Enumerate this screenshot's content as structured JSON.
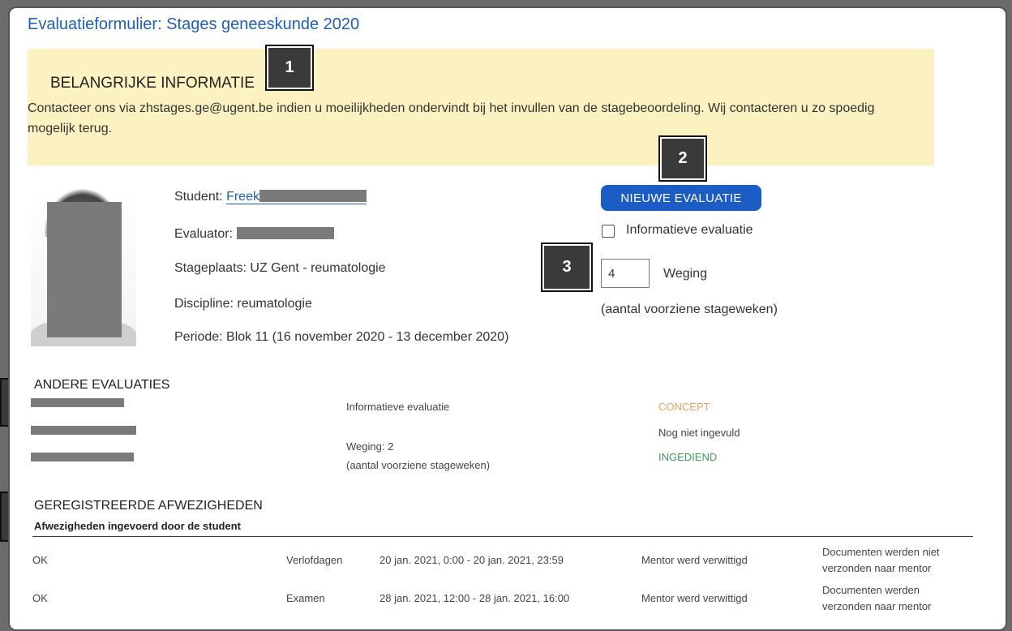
{
  "page": {
    "title": "Evaluatieformulier: Stages geneeskunde 2020"
  },
  "info": {
    "heading": "BELANGRIJKE INFORMATIE",
    "text": "Contacteer ons via zhstages.ge@ugent.be indien u moeilijkheden ondervindt bij het invullen van de stagebeoordeling. Wij contacteren u zo spoedig mogelijk terug."
  },
  "callouts": {
    "c1": "1",
    "c2": "2",
    "c3": "3"
  },
  "student": {
    "label": "Student:",
    "name": "Freek",
    "evaluator_label": "Evaluator:",
    "stageplaats": "Stageplaats: UZ Gent - reumatologie",
    "discipline": "Discipline: reumatologie",
    "periode": "Periode: Blok 11 (16 november 2020 - 13 december 2020)"
  },
  "actions": {
    "new_evaluation": "NIEUWE EVALUATIE",
    "informative_label": "Informatieve evaluatie",
    "weging_value": "4",
    "weging_label": "Weging",
    "weging_note": "(aantal voorziene stageweken)"
  },
  "other_evaluations": {
    "heading": "ANDERE EVALUATIES",
    "col2": {
      "informative": "Informatieve evaluatie",
      "weging": "Weging: 2",
      "weging_note": "(aantal voorziene stageweken)"
    },
    "statuses": {
      "concept": "CONCEPT",
      "not_filled": "Nog niet ingevuld",
      "ingediend": "INGEDIEND"
    },
    "colors": {
      "concept": "#e8a35a",
      "ingediend": "#3f9a5a"
    }
  },
  "absences": {
    "heading": "GEREGISTREERDE AFWEZIGHEDEN",
    "subheading": "Afwezigheden ingevoerd door de student",
    "rows": [
      {
        "status": "OK",
        "type": "Verlofdagen",
        "period": "20 jan. 2021, 0:00 - 20 jan. 2021, 23:59",
        "mentor": "Mentor werd verwittigd",
        "docs": "Documenten werden niet verzonden naar mentor"
      },
      {
        "status": "OK",
        "type": "Examen",
        "period": "28 jan. 2021, 12:00 - 28 jan. 2021, 16:00",
        "mentor": "Mentor werd verwittigd",
        "docs": "Documenten werden verzonden naar mentor"
      }
    ]
  }
}
